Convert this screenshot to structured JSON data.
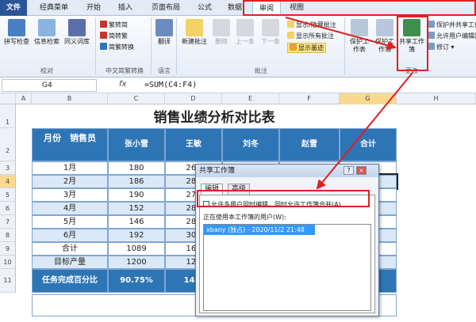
{
  "tabs": [
    "文件",
    "经典菜单",
    "开始",
    "插入",
    "页面布局",
    "公式",
    "数据",
    "审阅",
    "视图"
  ],
  "ribbon": {
    "proof": {
      "spell": "拼写检查",
      "research": "信息检索",
      "thesaurus": "同义词库",
      "label": "校对"
    },
    "chinese": {
      "to_trad": "繁转简",
      "to_simp": "简转繁",
      "convert": "简繁转换",
      "label": "中文简繁转换"
    },
    "language": {
      "translate": "翻译",
      "label": "语言"
    },
    "comments": {
      "new": "新建批注",
      "delete": "删除",
      "prev": "上一条",
      "next": "下一条",
      "show_hide": "显示/隐藏批注",
      "show_all": "显示所有批注",
      "show_ink": "显示墨迹",
      "label": "批注"
    },
    "changes": {
      "protect_sheet": "保护工作表",
      "protect_book": "保护工作簿",
      "share_book": "共享工作簿",
      "protect_share": "保护并共享工作簿",
      "allow_edit": "允许用户编辑区域",
      "track": "修订",
      "label": "更改"
    }
  },
  "formula_bar": {
    "name_box": "G4",
    "fx": "fx",
    "formula": "=SUM(C4:F4)"
  },
  "columns": [
    "A",
    "B",
    "C",
    "D",
    "E",
    "F",
    "G",
    "H"
  ],
  "rows": [
    "1",
    "2",
    "3",
    "4",
    "5",
    "6",
    "7",
    "8",
    "9",
    "10",
    "11"
  ],
  "sheet": {
    "title": "销售业绩分析对比表",
    "header": [
      "月份　销售员",
      "张小雪",
      "王敏",
      "刘冬",
      "赵雪",
      "合计"
    ],
    "data": [
      [
        "1月",
        "180",
        "268",
        "",
        "",
        "1019"
      ],
      [
        "2月",
        "186",
        "289",
        "",
        "",
        "9"
      ],
      [
        "3月",
        "190",
        "276",
        "",
        "",
        ""
      ],
      [
        "4月",
        "152",
        "280",
        "",
        "",
        ""
      ],
      [
        "5月",
        "146",
        "289",
        "",
        "",
        ""
      ],
      [
        "6月",
        "192",
        "300",
        "",
        "",
        ""
      ],
      [
        "合计",
        "1089",
        "168",
        "",
        "",
        ""
      ],
      [
        "目标产量",
        "1200",
        "120",
        "",
        "",
        ""
      ],
      [
        "任务完成百分比",
        "90.75%",
        "140.",
        "",
        "",
        "8%"
      ]
    ],
    "next_title": "任务"
  },
  "dialog": {
    "title": "共享工作簿",
    "help": "?",
    "close": "×",
    "tab_edit": "编辑",
    "tab_advanced": "高级",
    "checkbox_label": "允许多用户同时编辑，同时允许工作簿合并(A)",
    "users_label": "正在使用本工作簿的用户(W):",
    "users": [
      "xbany (独占) - 2020/11/2 21:48"
    ]
  }
}
